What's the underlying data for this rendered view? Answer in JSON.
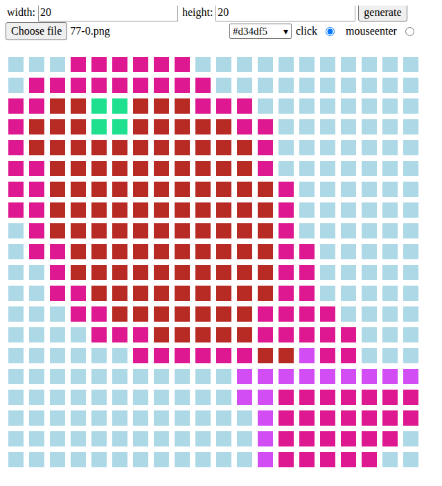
{
  "controls": {
    "width": {
      "label": "width:",
      "value": "20"
    },
    "height": {
      "label": "height:",
      "value": "20"
    },
    "generate": "generate",
    "file": {
      "button": "Choose file",
      "name": "77-0.png"
    },
    "color": {
      "value": "#d34df5",
      "arrow": "▾"
    },
    "modes": [
      {
        "label": "click",
        "selected": true
      },
      {
        "label": "mouseenter",
        "selected": false
      }
    ]
  },
  "grid": {
    "rows": [
      [
        "#add8e6",
        "#add8e6",
        "#add8e6",
        "#dd1890",
        "#dd1890",
        "#dd1890",
        "#dd1890",
        "#dd1890",
        "#dd1890",
        "#add8e6",
        "#add8e6",
        "#add8e6",
        "#add8e6",
        "#add8e6",
        "#add8e6",
        "#add8e6",
        "#add8e6",
        "#add8e6",
        "#add8e6",
        "#add8e6"
      ],
      [
        "#add8e6",
        "#dd1890",
        "#dd1890",
        "#dd1890",
        "#dd1890",
        "#dd1890",
        "#dd1890",
        "#dd1890",
        "#dd1890",
        "#dd1890",
        "#add8e6",
        "#add8e6",
        "#add8e6",
        "#add8e6",
        "#add8e6",
        "#add8e6",
        "#add8e6",
        "#add8e6",
        "#add8e6",
        "#add8e6"
      ],
      [
        "#dd1890",
        "#dd1890",
        "#b82a24",
        "#b82a24",
        "#1ee08f",
        "#1ee08f",
        "#b82a24",
        "#b82a24",
        "#b82a24",
        "#dd1890",
        "#dd1890",
        "#dd1890",
        "#add8e6",
        "#add8e6",
        "#add8e6",
        "#add8e6",
        "#add8e6",
        "#add8e6",
        "#add8e6",
        "#add8e6"
      ],
      [
        "#dd1890",
        "#b82a24",
        "#b82a24",
        "#b82a24",
        "#1ee08f",
        "#1ee08f",
        "#b82a24",
        "#b82a24",
        "#b82a24",
        "#b82a24",
        "#b82a24",
        "#dd1890",
        "#dd1890",
        "#add8e6",
        "#add8e6",
        "#add8e6",
        "#add8e6",
        "#add8e6",
        "#add8e6",
        "#add8e6"
      ],
      [
        "#dd1890",
        "#b82a24",
        "#b82a24",
        "#b82a24",
        "#b82a24",
        "#b82a24",
        "#b82a24",
        "#b82a24",
        "#b82a24",
        "#b82a24",
        "#b82a24",
        "#b82a24",
        "#dd1890",
        "#add8e6",
        "#add8e6",
        "#add8e6",
        "#add8e6",
        "#add8e6",
        "#add8e6",
        "#add8e6"
      ],
      [
        "#dd1890",
        "#dd1890",
        "#b82a24",
        "#b82a24",
        "#b82a24",
        "#b82a24",
        "#b82a24",
        "#b82a24",
        "#b82a24",
        "#b82a24",
        "#b82a24",
        "#b82a24",
        "#dd1890",
        "#add8e6",
        "#add8e6",
        "#add8e6",
        "#add8e6",
        "#add8e6",
        "#add8e6",
        "#add8e6"
      ],
      [
        "#dd1890",
        "#dd1890",
        "#b82a24",
        "#b82a24",
        "#b82a24",
        "#b82a24",
        "#b82a24",
        "#b82a24",
        "#b82a24",
        "#b82a24",
        "#b82a24",
        "#b82a24",
        "#b82a24",
        "#dd1890",
        "#add8e6",
        "#add8e6",
        "#add8e6",
        "#add8e6",
        "#add8e6",
        "#add8e6"
      ],
      [
        "#dd1890",
        "#dd1890",
        "#b82a24",
        "#b82a24",
        "#b82a24",
        "#b82a24",
        "#b82a24",
        "#b82a24",
        "#b82a24",
        "#b82a24",
        "#b82a24",
        "#b82a24",
        "#b82a24",
        "#dd1890",
        "#add8e6",
        "#add8e6",
        "#add8e6",
        "#add8e6",
        "#add8e6",
        "#add8e6"
      ],
      [
        "#add8e6",
        "#dd1890",
        "#b82a24",
        "#b82a24",
        "#b82a24",
        "#b82a24",
        "#b82a24",
        "#b82a24",
        "#b82a24",
        "#b82a24",
        "#b82a24",
        "#b82a24",
        "#b82a24",
        "#dd1890",
        "#add8e6",
        "#add8e6",
        "#add8e6",
        "#add8e6",
        "#add8e6",
        "#add8e6"
      ],
      [
        "#add8e6",
        "#dd1890",
        "#dd1890",
        "#b82a24",
        "#b82a24",
        "#b82a24",
        "#b82a24",
        "#b82a24",
        "#b82a24",
        "#b82a24",
        "#b82a24",
        "#b82a24",
        "#b82a24",
        "#dd1890",
        "#dd1890",
        "#add8e6",
        "#add8e6",
        "#add8e6",
        "#add8e6",
        "#add8e6"
      ],
      [
        "#add8e6",
        "#add8e6",
        "#dd1890",
        "#b82a24",
        "#b82a24",
        "#b82a24",
        "#b82a24",
        "#b82a24",
        "#b82a24",
        "#b82a24",
        "#b82a24",
        "#b82a24",
        "#b82a24",
        "#dd1890",
        "#dd1890",
        "#add8e6",
        "#add8e6",
        "#add8e6",
        "#add8e6",
        "#add8e6"
      ],
      [
        "#add8e6",
        "#add8e6",
        "#dd1890",
        "#dd1890",
        "#b82a24",
        "#b82a24",
        "#b82a24",
        "#b82a24",
        "#b82a24",
        "#b82a24",
        "#b82a24",
        "#b82a24",
        "#b82a24",
        "#dd1890",
        "#dd1890",
        "#add8e6",
        "#add8e6",
        "#add8e6",
        "#add8e6",
        "#add8e6"
      ],
      [
        "#add8e6",
        "#add8e6",
        "#add8e6",
        "#dd1890",
        "#dd1890",
        "#b82a24",
        "#b82a24",
        "#b82a24",
        "#b82a24",
        "#b82a24",
        "#b82a24",
        "#b82a24",
        "#dd1890",
        "#dd1890",
        "#dd1890",
        "#dd1890",
        "#add8e6",
        "#add8e6",
        "#add8e6",
        "#add8e6"
      ],
      [
        "#add8e6",
        "#add8e6",
        "#add8e6",
        "#add8e6",
        "#dd1890",
        "#dd1890",
        "#dd1890",
        "#b82a24",
        "#b82a24",
        "#b82a24",
        "#b82a24",
        "#b82a24",
        "#dd1890",
        "#dd1890",
        "#dd1890",
        "#dd1890",
        "#dd1890",
        "#add8e6",
        "#add8e6",
        "#add8e6"
      ],
      [
        "#add8e6",
        "#add8e6",
        "#add8e6",
        "#add8e6",
        "#add8e6",
        "#add8e6",
        "#dd1890",
        "#dd1890",
        "#dd1890",
        "#dd1890",
        "#dd1890",
        "#dd1890",
        "#b82a24",
        "#b82a24",
        "#d34df5",
        "#dd1890",
        "#dd1890",
        "#add8e6",
        "#add8e6",
        "#add8e6"
      ],
      [
        "#add8e6",
        "#add8e6",
        "#add8e6",
        "#add8e6",
        "#add8e6",
        "#add8e6",
        "#add8e6",
        "#add8e6",
        "#add8e6",
        "#add8e6",
        "#add8e6",
        "#d34df5",
        "#d34df5",
        "#d34df5",
        "#d34df5",
        "#d34df5",
        "#d34df5",
        "#d34df5",
        "#d34df5",
        "#d34df5"
      ],
      [
        "#add8e6",
        "#add8e6",
        "#add8e6",
        "#add8e6",
        "#add8e6",
        "#add8e6",
        "#add8e6",
        "#add8e6",
        "#add8e6",
        "#add8e6",
        "#add8e6",
        "#d34df5",
        "#d34df5",
        "#dd1890",
        "#dd1890",
        "#dd1890",
        "#dd1890",
        "#dd1890",
        "#dd1890",
        "#dd1890"
      ],
      [
        "#add8e6",
        "#add8e6",
        "#add8e6",
        "#add8e6",
        "#add8e6",
        "#add8e6",
        "#add8e6",
        "#add8e6",
        "#add8e6",
        "#add8e6",
        "#add8e6",
        "#add8e6",
        "#d34df5",
        "#dd1890",
        "#dd1890",
        "#dd1890",
        "#dd1890",
        "#dd1890",
        "#dd1890",
        "#dd1890"
      ],
      [
        "#add8e6",
        "#add8e6",
        "#add8e6",
        "#add8e6",
        "#add8e6",
        "#add8e6",
        "#add8e6",
        "#add8e6",
        "#add8e6",
        "#add8e6",
        "#add8e6",
        "#add8e6",
        "#d34df5",
        "#dd1890",
        "#dd1890",
        "#dd1890",
        "#dd1890",
        "#dd1890",
        "#dd1890",
        "#add8e6"
      ],
      [
        "#add8e6",
        "#add8e6",
        "#add8e6",
        "#add8e6",
        "#add8e6",
        "#add8e6",
        "#add8e6",
        "#add8e6",
        "#add8e6",
        "#add8e6",
        "#add8e6",
        "#add8e6",
        "#d34df5",
        "#dd1890",
        "#dd1890",
        "#dd1890",
        "#dd1890",
        "#dd1890",
        "#add8e6",
        "#add8e6"
      ]
    ]
  }
}
